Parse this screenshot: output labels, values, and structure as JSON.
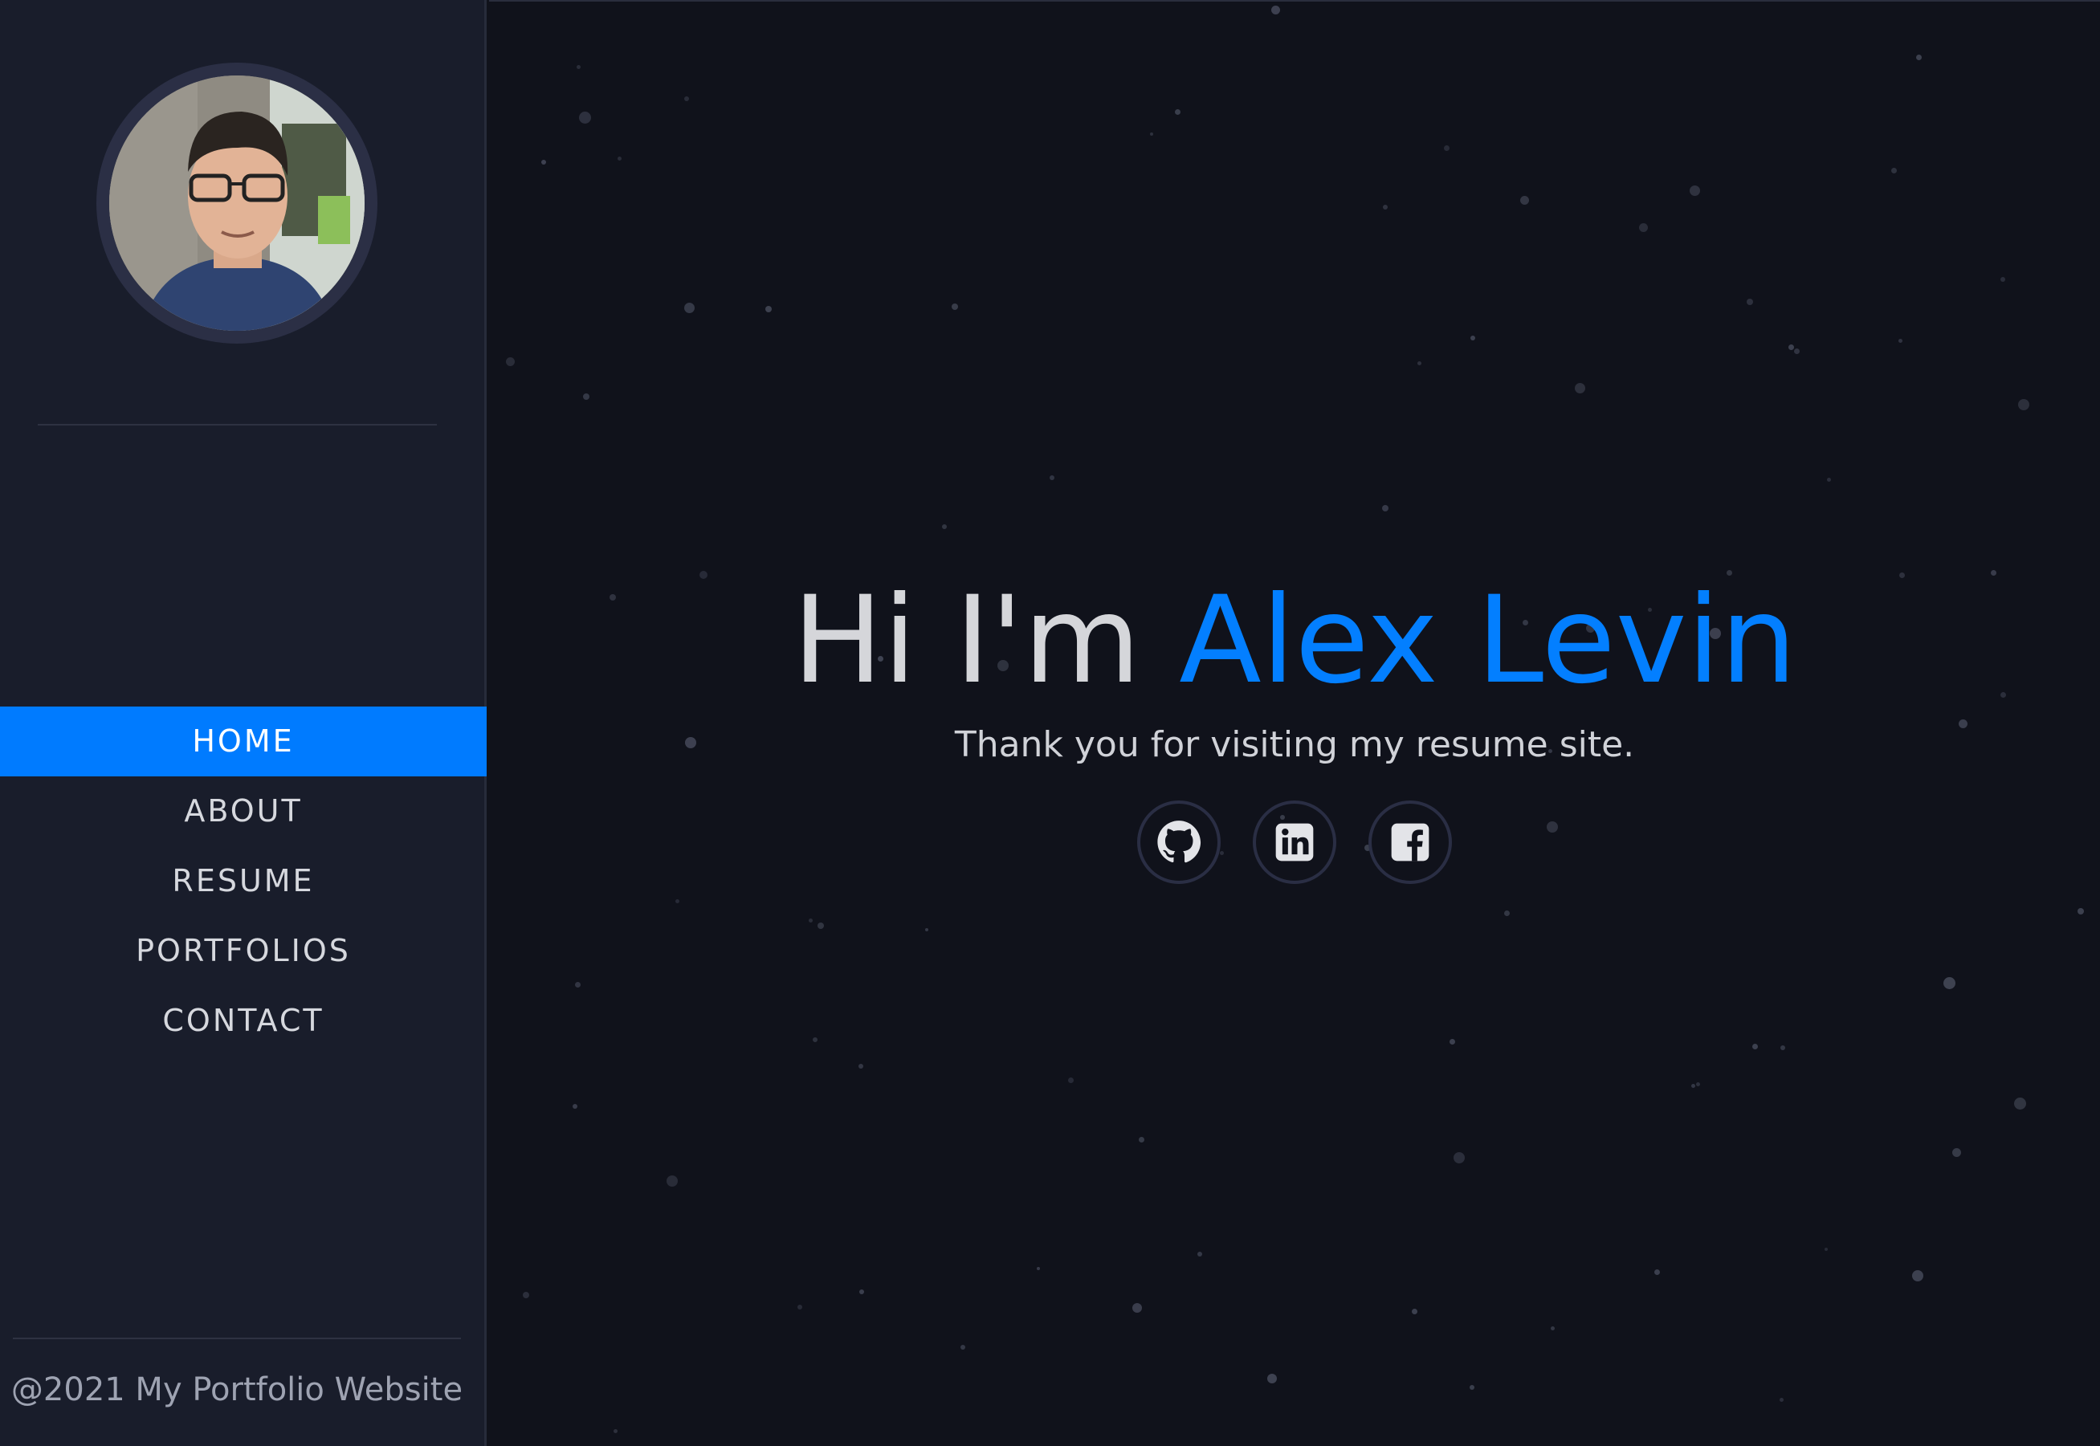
{
  "sidebar": {
    "avatar_alt": "Alex Levin profile photo",
    "nav": [
      {
        "label": "HOME",
        "active": true
      },
      {
        "label": "ABOUT",
        "active": false
      },
      {
        "label": "RESUME",
        "active": false
      },
      {
        "label": "PORTFOLIOS",
        "active": false
      },
      {
        "label": "CONTACT",
        "active": false
      }
    ],
    "footer": "@2021 My Portfolio Website"
  },
  "hero": {
    "greeting": "Hi I'm",
    "name": "Alex Levin",
    "subtitle": "Thank you for visiting my resume site.",
    "socials": [
      {
        "name": "github",
        "icon": "github-icon"
      },
      {
        "name": "linkedin",
        "icon": "linkedin-icon"
      },
      {
        "name": "facebook",
        "icon": "facebook-icon"
      }
    ]
  },
  "colors": {
    "accent": "#037fff",
    "sidebar_bg": "#191d2b",
    "main_bg": "#10121b"
  }
}
